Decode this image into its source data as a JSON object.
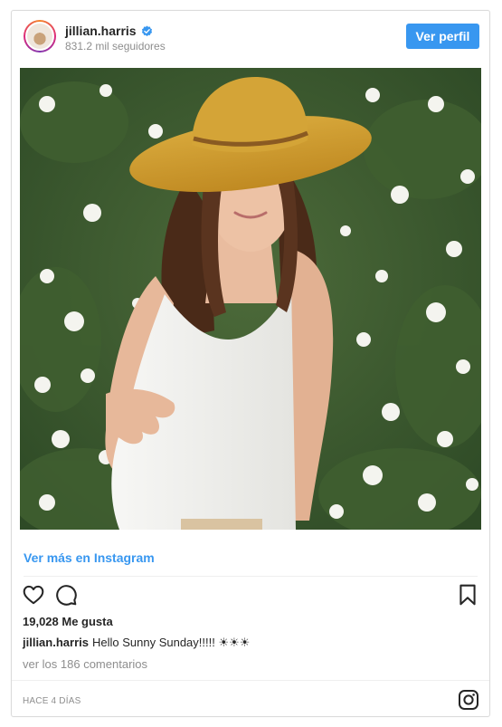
{
  "header": {
    "username": "jillian.harris",
    "verified": true,
    "followers": "831.2 mil seguidores",
    "profile_button": "Ver perfil"
  },
  "post": {
    "image_alt": "",
    "view_more_link": "Ver más en Instagram",
    "likes": "19,028 Me gusta",
    "caption_user": "jillian.harris",
    "caption_text": "Hello Sunny Sunday!!!!! ☀☀☀",
    "comments_link": "ver los 186 comentarios",
    "timestamp": "HACE 4 DÍAS"
  },
  "colors": {
    "accent": "#3897f0",
    "text": "#262626",
    "muted": "#8e8e8e"
  },
  "icons": [
    "verified-badge-icon",
    "heart-icon",
    "comment-icon",
    "bookmark-icon",
    "instagram-logo-icon"
  ]
}
